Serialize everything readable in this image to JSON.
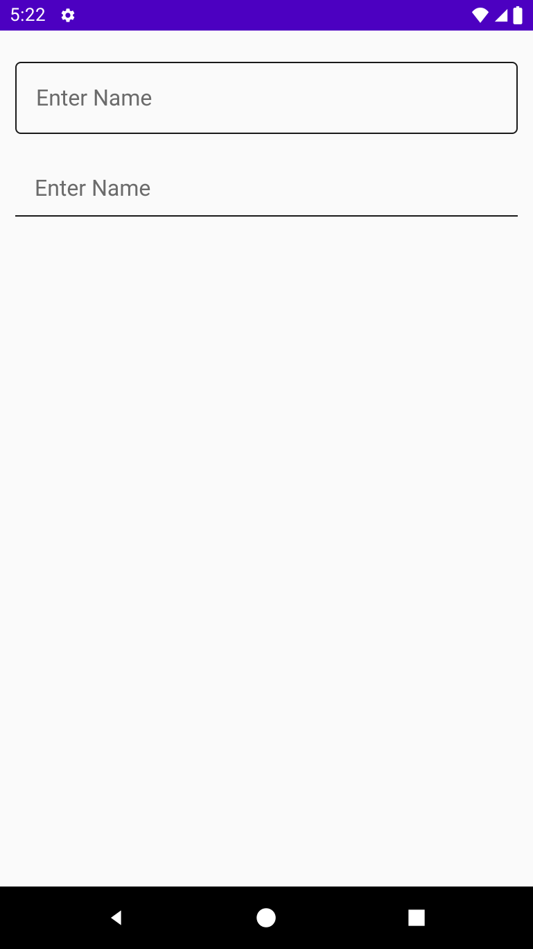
{
  "statusBar": {
    "time": "5:22",
    "color": "#4c00c1"
  },
  "inputs": {
    "field1": {
      "placeholder": "Enter Name",
      "value": ""
    },
    "field2": {
      "placeholder": "Enter Name",
      "value": ""
    }
  }
}
